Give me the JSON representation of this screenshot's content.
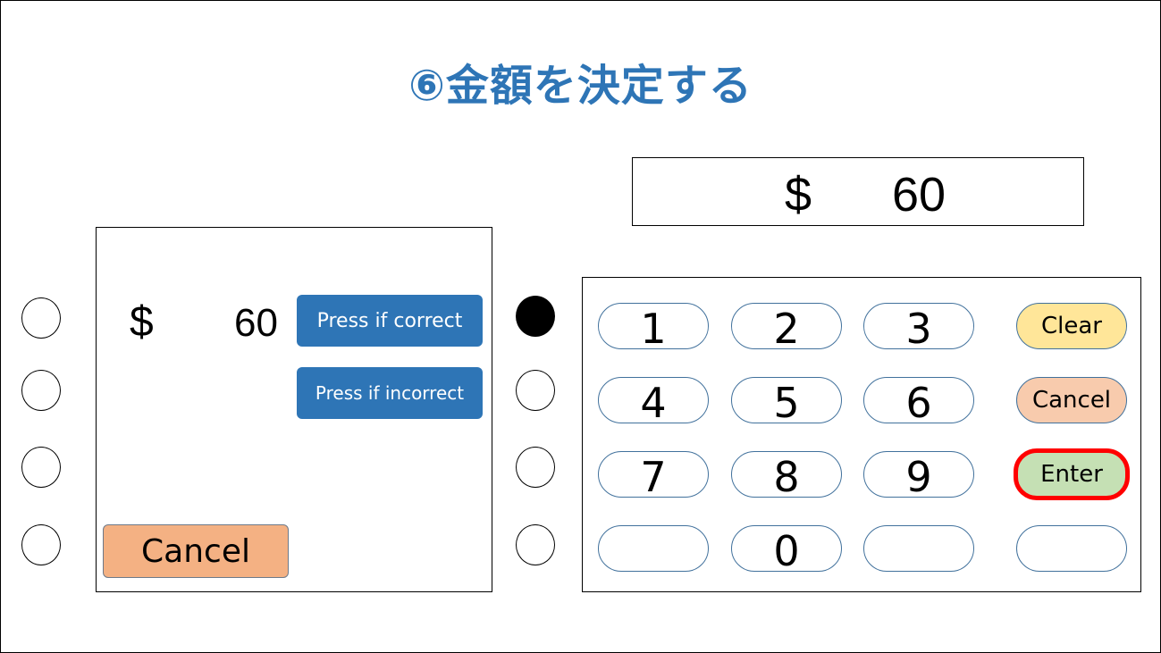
{
  "title": "⑥金額を決定する",
  "display": {
    "currency": "$",
    "amount": "60"
  },
  "screen": {
    "currency": "$",
    "amount": "60",
    "correct_label": "Press if correct",
    "incorrect_label": "Press if incorrect",
    "cancel_label": "Cancel"
  },
  "left_side_buttons": [
    {
      "state": "empty"
    },
    {
      "state": "empty"
    },
    {
      "state": "empty"
    },
    {
      "state": "empty"
    }
  ],
  "right_side_buttons": [
    {
      "state": "pressed"
    },
    {
      "state": "empty"
    },
    {
      "state": "empty"
    },
    {
      "state": "empty"
    }
  ],
  "keypad": {
    "keys": [
      [
        "1",
        "2",
        "3"
      ],
      [
        "4",
        "5",
        "6"
      ],
      [
        "7",
        "8",
        "9"
      ],
      [
        "",
        "0",
        ""
      ]
    ],
    "functions": {
      "clear": "Clear",
      "cancel": "Cancel",
      "enter": "Enter",
      "blank": ""
    },
    "highlighted": "Enter"
  },
  "colors": {
    "title": "#2E75B6",
    "primary_button": "#2E75B6",
    "cancel_button": "#F4B183",
    "clear_key": "#FFE699",
    "cancel_key": "#F8CBAD",
    "enter_key": "#C5E0B4",
    "highlight": "#FF0000"
  }
}
